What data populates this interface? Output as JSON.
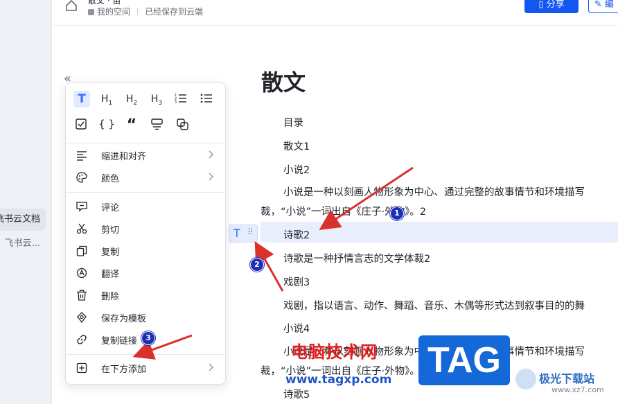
{
  "sidebar": {
    "items": [
      {
        "label": "飞书云文档",
        "active": true
      },
      {
        "label": "飞书云...",
        "active": false
      }
    ]
  },
  "topbar": {
    "doc_title": "散文 · 苗",
    "breadcrumb_space": "我的空间",
    "save_status": "已经保存到云端",
    "share_label": "分享",
    "edit_label": "编"
  },
  "menu": {
    "format_row1": [
      "T",
      "H1",
      "H2",
      "H3",
      "ordered-list",
      "bullet-list"
    ],
    "format_row2": [
      "todo",
      "{}",
      "quote",
      "callout",
      "sync-block"
    ],
    "items_group1": [
      {
        "label": "缩进和对齐",
        "icon": "align-icon",
        "submenu": true
      },
      {
        "label": "颜色",
        "icon": "palette-icon",
        "submenu": true
      }
    ],
    "items_group2": [
      {
        "label": "评论",
        "icon": "comment-icon"
      },
      {
        "label": "剪切",
        "icon": "scissors-icon"
      },
      {
        "label": "复制",
        "icon": "copy-icon"
      },
      {
        "label": "翻译",
        "icon": "translate-icon"
      },
      {
        "label": "删除",
        "icon": "trash-icon"
      },
      {
        "label": "保存为模板",
        "icon": "template-icon"
      },
      {
        "label": "复制链接",
        "icon": "link-icon"
      }
    ],
    "items_group3": [
      {
        "label": "在下方添加",
        "icon": "add-below-icon",
        "submenu": true
      }
    ]
  },
  "document": {
    "heading": "散文",
    "lines": [
      "目录",
      "散文1",
      "小说2",
      "小说是一种以刻画人物形象为中心、通过完整的故事情节和环境描写",
      "裁，“小说”一词出自《庄子·外物》。2",
      "诗歌2",
      "诗歌是一种抒情言志的文学体裁2",
      "戏剧3",
      "戏剧，指以语言、动作、舞蹈、音乐、木偶等形式达到叙事目的的舞",
      "小说4",
      "小说是一种以刻画人物形象为中心、通过完整的故事情节和环境描写",
      "裁，“小说”一词出自《庄子·外物》。4",
      "诗歌5"
    ],
    "selected_line": "诗歌2"
  },
  "block_handle": {
    "type_label": "T",
    "drag_label": "⠿"
  },
  "annotations": {
    "badges": [
      "1",
      "2",
      "3"
    ],
    "arrow_color": "#d9312b",
    "badge_color": "#1c2fb8"
  },
  "watermark": {
    "site_cn": "电脑技术网",
    "url": "www.tagxp.com",
    "tag": "TAG",
    "brand2": "极光下载站",
    "url2": "www.xz7.com"
  },
  "colors": {
    "accent": "#1456f0",
    "selection": "#e8eefc",
    "menu_selected": "#3370ff"
  }
}
